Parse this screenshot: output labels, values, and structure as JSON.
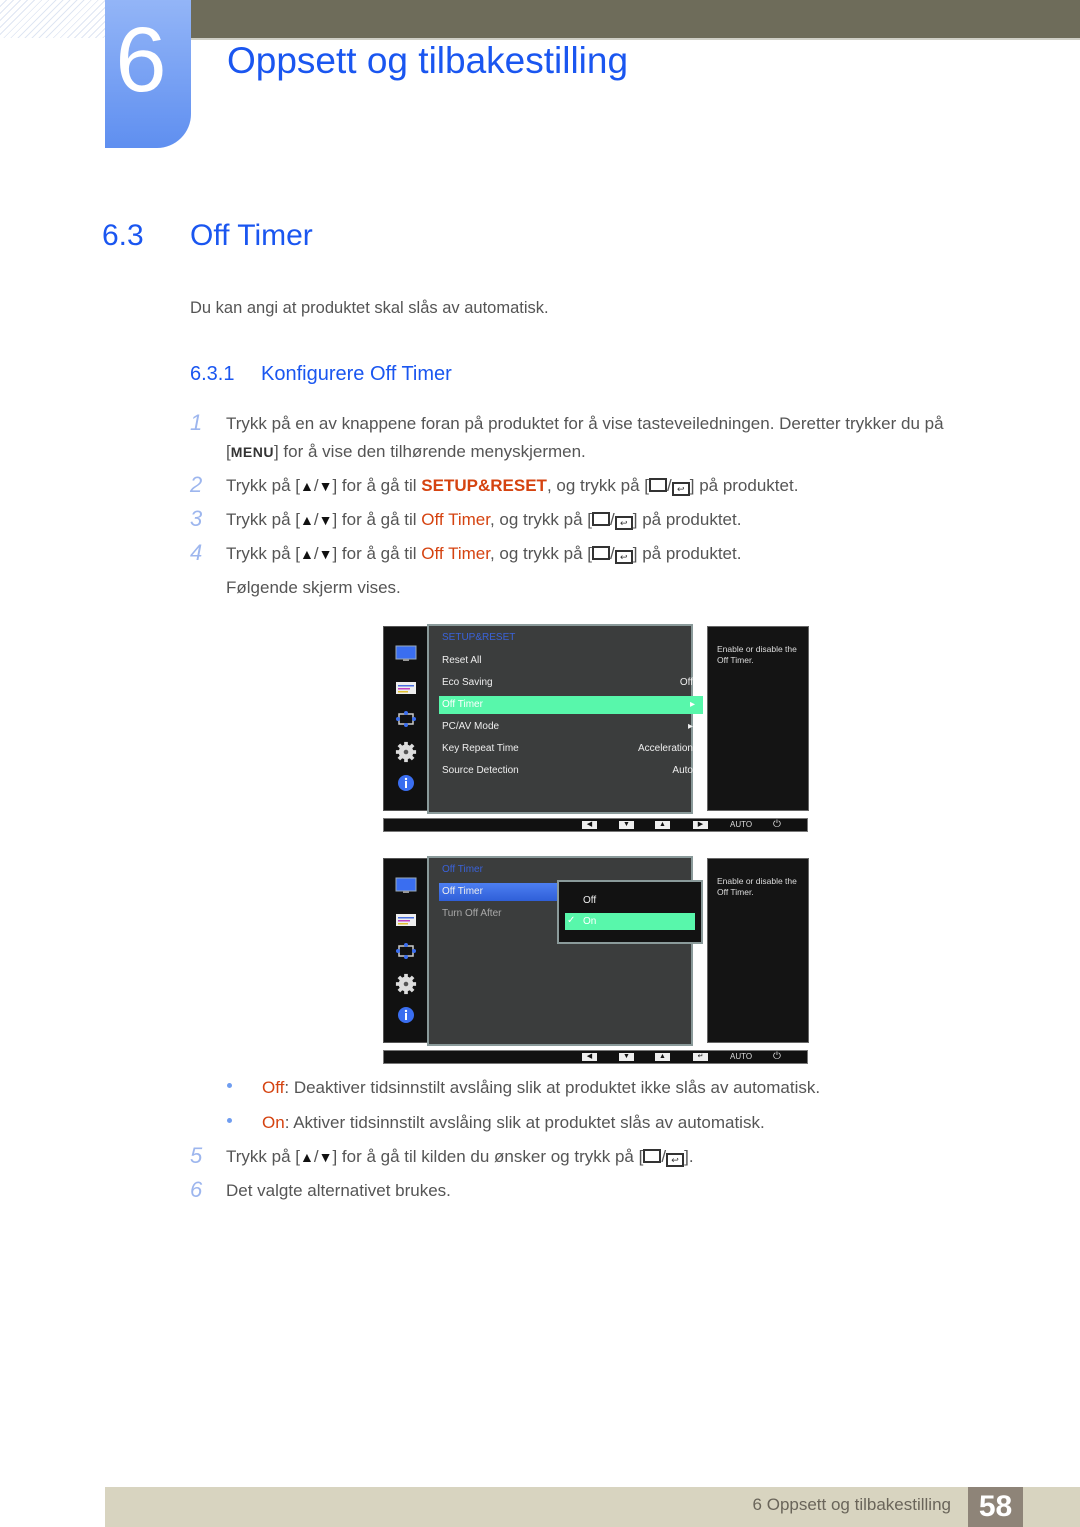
{
  "chapter": {
    "number": "6",
    "title": "Oppsett og tilbakestilling"
  },
  "section": {
    "number": "6.3",
    "title": "Off Timer",
    "intro": "Du kan angi at produktet skal slås av automatisk."
  },
  "subsection": {
    "number": "6.3.1",
    "title": "Konfigurere Off Timer"
  },
  "steps": [
    {
      "n": "1",
      "line1": "Trykk på en av knappene foran på produktet for å vise tasteveiledningen. Deretter trykker du på",
      "key": "MENU",
      "line2": "for å vise den tilhørende menyskjermen."
    },
    {
      "n": "2",
      "pre": "Trykk på",
      "mid": "for å gå til",
      "target": "SETUP&RESET",
      "post": ", og trykk på",
      "end": "på produktet."
    },
    {
      "n": "3",
      "pre": "Trykk på",
      "mid": "for å gå til",
      "target": "Off Timer",
      "post": ", og trykk på",
      "end": "på produktet."
    },
    {
      "n": "4",
      "pre": "Trykk på",
      "mid": "for å gå til",
      "target": "Off Timer",
      "post": ", og trykk på",
      "end": "på produktet.",
      "line2": "Følgende skjerm vises."
    },
    {
      "n": "5",
      "pre": "Trykk på",
      "mid": "for å gå til kilden du ønsker og trykk på",
      "end": "."
    },
    {
      "n": "6",
      "text": "Det valgte alternativet brukes."
    }
  ],
  "keys": {
    "up": "▲",
    "slash": "/",
    "down": "▼"
  },
  "bullets": [
    {
      "term": "Off",
      "text": ": Deaktiver tidsinnstilt avslåing slik at produktet ikke slås av automatisk."
    },
    {
      "term": "On",
      "text": ": Aktiver tidsinnstilt avslåing slik at produktet slås av automatisk."
    }
  ],
  "osd1": {
    "title": "SETUP&RESET",
    "rows": [
      {
        "label": "Reset All",
        "value": ""
      },
      {
        "label": "Eco Saving",
        "value": "Off"
      },
      {
        "label": "Off Timer",
        "value": "▸",
        "selected": true
      },
      {
        "label": "PC/AV Mode",
        "value": "▸"
      },
      {
        "label": "Key Repeat Time",
        "value": "Acceleration"
      },
      {
        "label": "Source Detection",
        "value": "Auto"
      }
    ],
    "help": "Enable or disable the Off Timer.",
    "bar": {
      "left": "◀",
      "down": "▼",
      "up": "▲",
      "right": "▶",
      "auto": "AUTO",
      "power": "⏻"
    }
  },
  "osd2": {
    "title": "Off Timer",
    "rows": [
      {
        "label": "Off Timer",
        "active": true
      },
      {
        "label": "Turn Off After"
      }
    ],
    "popup": [
      {
        "label": "Off"
      },
      {
        "label": "On",
        "selected": true,
        "check": "✓"
      }
    ],
    "help": "Enable or disable the Off Timer.",
    "bar": {
      "left": "◀",
      "down": "▼",
      "up": "▲",
      "enter": "↵",
      "auto": "AUTO",
      "power": "⏻"
    }
  },
  "footer": {
    "text": "6 Oppsett og tilbakestilling",
    "page": "58"
  },
  "colors": {
    "heading": "#1a56f0",
    "highlight": "#d54310",
    "osd_select": "#58f7ab",
    "topbar": "#6e6c5a",
    "footer": "#d8d4c0"
  }
}
